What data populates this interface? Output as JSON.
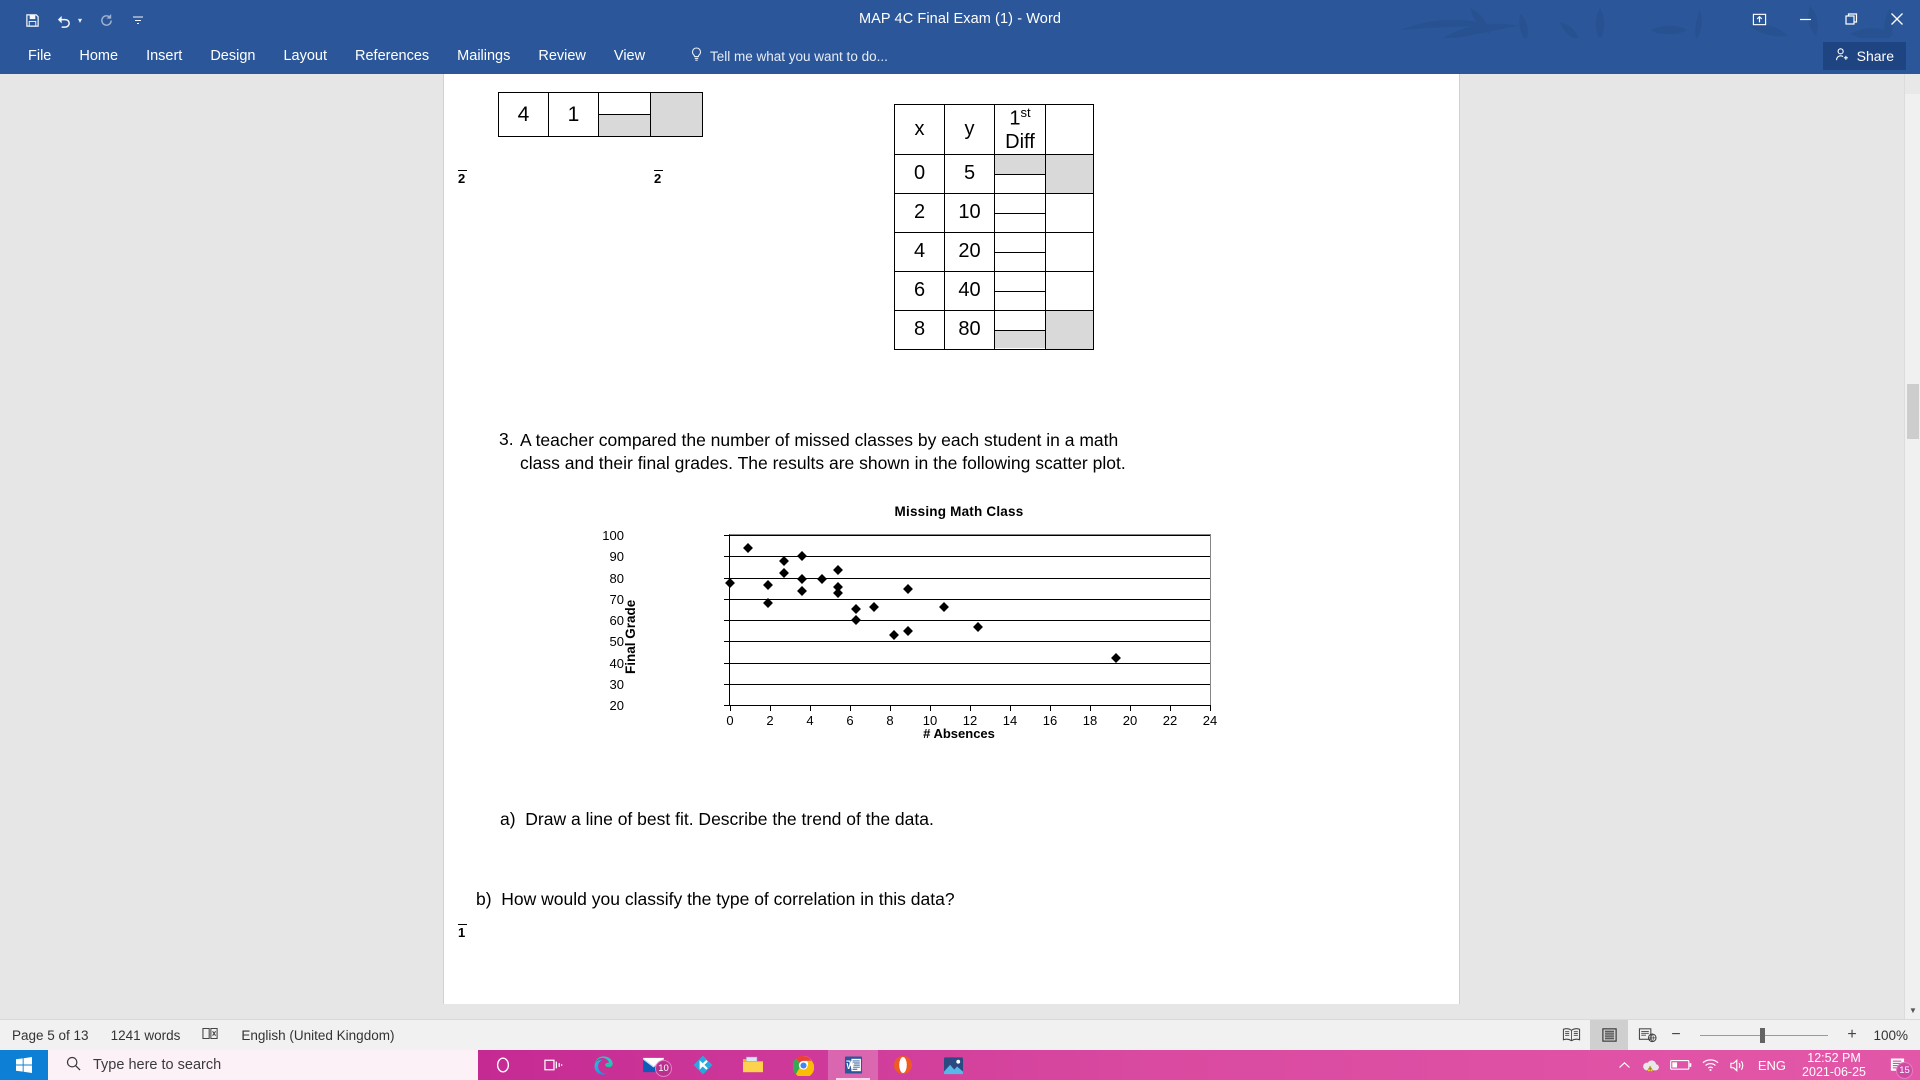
{
  "window": {
    "title": "MAP 4C Final Exam (1) - Word",
    "quick_access": [
      "save-icon",
      "undo-icon",
      "redo-icon",
      "customize-icon"
    ],
    "controls": {
      "ribbon_display_options": "ribbon-options-icon",
      "minimize": "minimize-icon",
      "restore": "restore-icon",
      "close": "close-icon"
    },
    "accent_color": "#2b579a"
  },
  "ribbon": {
    "tabs": [
      "File",
      "Home",
      "Insert",
      "Design",
      "Layout",
      "References",
      "Mailings",
      "Review",
      "View"
    ],
    "tell_me": "Tell me what you want to do...",
    "share_label": "Share"
  },
  "document": {
    "top_table": {
      "cells": [
        "4",
        "1"
      ],
      "has_split_cell": true,
      "has_shaded_cell": true
    },
    "margin_marks": [
      "2",
      "2",
      "1"
    ],
    "xy_table": {
      "headers": [
        "x",
        "y",
        "1st Diff",
        ""
      ],
      "header_sup": "st",
      "header_main": "1",
      "header_second_line": "Diff",
      "rows": [
        {
          "x": "0",
          "y": "5"
        },
        {
          "x": "2",
          "y": "10"
        },
        {
          "x": "4",
          "y": "20"
        },
        {
          "x": "6",
          "y": "40"
        },
        {
          "x": "8",
          "y": "80"
        }
      ]
    },
    "question": {
      "number": "3.",
      "text": "A teacher compared the number of missed classes by each student in a math class and their final grades. The results are shown in the following scatter plot.",
      "parts": [
        {
          "label": "a)",
          "text": "Draw a line of best fit. Describe the trend of the data."
        },
        {
          "label": "b)",
          "text": "How would you classify the type of correlation in this data?"
        }
      ]
    }
  },
  "chart_data": {
    "type": "scatter",
    "title": "Missing Math Class",
    "xlabel": "# Absences",
    "ylabel": "Final Grade",
    "xlim": [
      0,
      24
    ],
    "ylim": [
      20,
      100
    ],
    "xticks": [
      0,
      2,
      4,
      6,
      8,
      10,
      12,
      14,
      16,
      18,
      20,
      22,
      24
    ],
    "yticks": [
      20,
      30,
      40,
      50,
      60,
      70,
      80,
      90,
      100
    ],
    "grid": "horizontal",
    "legend": "none",
    "marker": "diamond",
    "marker_color": "#000000",
    "points": [
      {
        "x": 0.0,
        "y": 77.5
      },
      {
        "x": 0.9,
        "y": 94.0
      },
      {
        "x": 1.9,
        "y": 76.5
      },
      {
        "x": 1.9,
        "y": 68.0
      },
      {
        "x": 2.7,
        "y": 88.0
      },
      {
        "x": 2.7,
        "y": 82.0
      },
      {
        "x": 3.6,
        "y": 90.0
      },
      {
        "x": 3.6,
        "y": 79.5
      },
      {
        "x": 3.6,
        "y": 73.5
      },
      {
        "x": 4.6,
        "y": 79.5
      },
      {
        "x": 5.4,
        "y": 83.5
      },
      {
        "x": 5.4,
        "y": 75.5
      },
      {
        "x": 5.4,
        "y": 72.5
      },
      {
        "x": 6.3,
        "y": 65.0
      },
      {
        "x": 6.3,
        "y": 60.0
      },
      {
        "x": 7.2,
        "y": 66.0
      },
      {
        "x": 8.2,
        "y": 53.0
      },
      {
        "x": 8.9,
        "y": 55.0
      },
      {
        "x": 8.9,
        "y": 74.5
      },
      {
        "x": 10.7,
        "y": 66.0
      },
      {
        "x": 12.4,
        "y": 56.5
      },
      {
        "x": 19.3,
        "y": 42.0
      }
    ]
  },
  "status_bar": {
    "page": "Page 5 of 13",
    "words": "1241 words",
    "proofing_icon": "proofing-errors-icon",
    "language": "English (United Kingdom)",
    "views": [
      "read-mode-icon",
      "print-layout-icon",
      "web-layout-icon"
    ],
    "active_view": "print-layout-icon",
    "zoom_out": "−",
    "zoom_in": "+",
    "zoom_level": "100%"
  },
  "taskbar": {
    "start": "windows-start-icon",
    "search_placeholder": "Type here to search",
    "search_icon": "search-icon",
    "items": [
      {
        "name": "cortana-icon",
        "badge": null
      },
      {
        "name": "task-view-icon",
        "badge": null
      },
      {
        "name": "edge-icon",
        "badge": null
      },
      {
        "name": "mail-icon",
        "badge": "10"
      },
      {
        "name": "kodi-icon",
        "badge": null
      },
      {
        "name": "file-explorer-icon",
        "badge": null
      },
      {
        "name": "chrome-icon",
        "badge": null
      },
      {
        "name": "word-icon",
        "badge": null
      },
      {
        "name": "opera-icon",
        "badge": null
      },
      {
        "name": "photos-icon",
        "badge": null
      }
    ],
    "tray": {
      "show_hidden": "chevron-up-icon",
      "onedrive": "onedrive-warning-icon",
      "battery": "battery-icon",
      "wifi": "wifi-icon",
      "volume": "volume-icon",
      "language": "ENG",
      "time": "12:52 PM",
      "date": "2021-06-25",
      "notifications_icon": "action-center-icon",
      "notifications_count": "15"
    }
  }
}
